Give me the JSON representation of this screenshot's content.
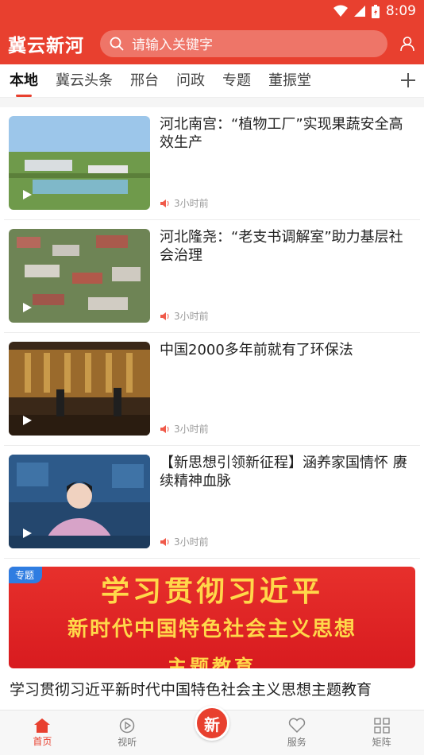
{
  "status": {
    "time": "8:09"
  },
  "header": {
    "logo": "冀云新河",
    "search_placeholder": "请输入关键字"
  },
  "tabs": [
    {
      "label": "本地",
      "active": true
    },
    {
      "label": "冀云头条"
    },
    {
      "label": "邢台"
    },
    {
      "label": "问政"
    },
    {
      "label": "专题"
    },
    {
      "label": "董振堂"
    }
  ],
  "news": [
    {
      "title": "河北南宫：“植物工厂”实现果蔬安全高效生产",
      "time": "3小时前"
    },
    {
      "title": "河北隆尧：“老支书调解室”助力基层社会治理",
      "time": "3小时前"
    },
    {
      "title": "中国2000多年前就有了环保法",
      "time": "3小时前"
    },
    {
      "title": "【新思想引领新征程】涵养家国情怀 赓续精神血脉",
      "time": "3小时前"
    }
  ],
  "special": {
    "badge": "专题",
    "banner_line1": "学习贯彻习近平",
    "banner_line2": "新时代中国特色社会主义思想",
    "banner_line3": "主题教育",
    "title": "学习贯彻习近平新时代中国特色社会主义思想主题教育"
  },
  "bottom_nav": {
    "home": "首页",
    "listen": "视听",
    "center": "新",
    "service": "服务",
    "matrix": "矩阵"
  },
  "colors": {
    "brand": "#e8402f",
    "accent_blue": "#2f7de1",
    "banner_text": "#ffd84a"
  }
}
